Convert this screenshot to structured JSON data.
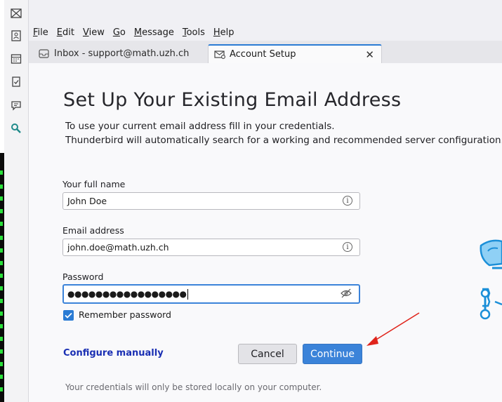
{
  "menu": [
    "File",
    "Edit",
    "View",
    "Go",
    "Message",
    "Tools",
    "Help"
  ],
  "menu_mnemonics": [
    "F",
    "E",
    "V",
    "G",
    "M",
    "T",
    "H"
  ],
  "tabs": [
    {
      "label": "Inbox - support@math.uzh.ch",
      "icon": "inbox-icon"
    },
    {
      "label": "Account Setup",
      "icon": "envelope-gear-icon"
    }
  ],
  "sidebar_icons": [
    "mail-icon",
    "address-book-icon",
    "calendar-icon",
    "tasks-icon",
    "chat-icon",
    "search-icon"
  ],
  "setup": {
    "title": "Set Up Your Existing Email Address",
    "intro_line1": "To use your current email address fill in your credentials.",
    "intro_line2": "Thunderbird will automatically search for a working and recommended server configuration.",
    "name_label": "Your full name",
    "name_value": "John Doe",
    "email_label": "Email address",
    "email_value": "john.doe@math.uzh.ch",
    "password_label": "Password",
    "password_value": "●●●●●●●●●●●●●●●●●",
    "remember_label": "Remember password",
    "remember_checked": true,
    "configure_manually": "Configure manually",
    "cancel": "Cancel",
    "continue": "Continue",
    "footnote": "Your credentials will only be stored locally on your computer."
  },
  "colors": {
    "accent": "#3b83d9",
    "link": "#1a2fb3",
    "annotation_arrow": "#e0241b"
  }
}
